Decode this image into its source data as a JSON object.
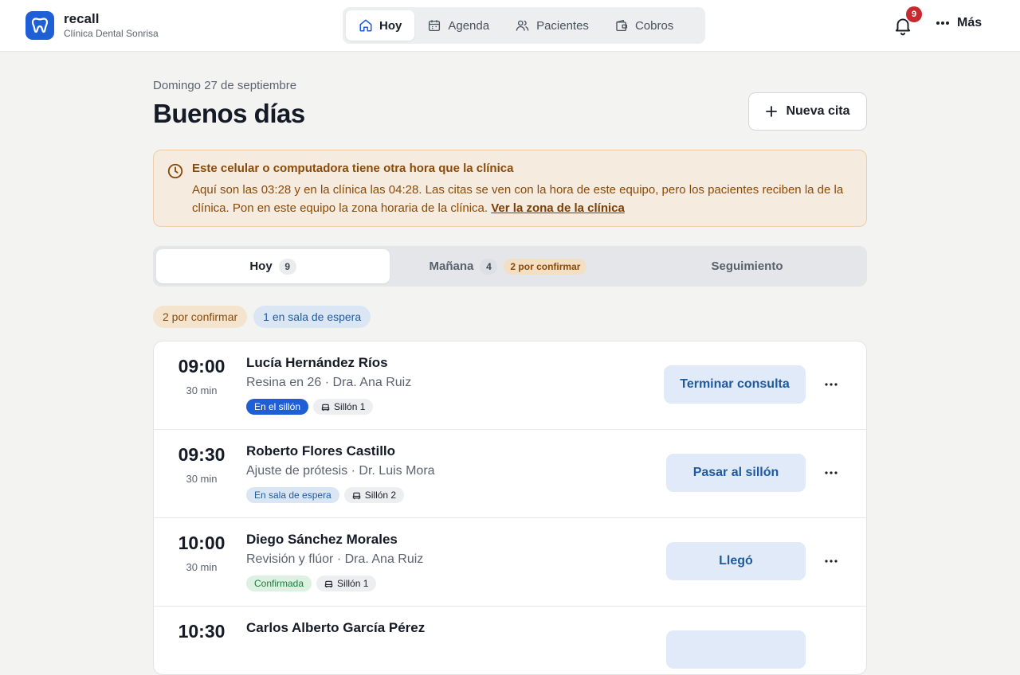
{
  "brand": {
    "name": "recall",
    "clinic": "Clínica Dental Sonrisa",
    "logo_icon": "tooth-icon",
    "color": "#1f5fd6"
  },
  "nav": [
    {
      "label": "Hoy",
      "icon": "home-icon",
      "active": true
    },
    {
      "label": "Agenda",
      "icon": "calendar-icon",
      "active": false
    },
    {
      "label": "Pacientes",
      "icon": "users-icon",
      "active": false
    },
    {
      "label": "Cobros",
      "icon": "wallet-icon",
      "active": false
    }
  ],
  "notifications": {
    "icon": "bell-icon",
    "count": "9"
  },
  "more": {
    "label": "Más",
    "icon": "more-icon"
  },
  "header": {
    "date": "Domingo 27 de septiembre",
    "greeting": "Buenos días",
    "new_button": "Nueva cita"
  },
  "alert": {
    "icon": "clock-icon",
    "title": "Este celular o computadora tiene otra hora que la clínica",
    "body": "Aquí son las 03:28 y en la clínica las 04:28. Las citas se ven con la hora de este equipo, pero los pacientes reciben la de la clínica. Pon en este equipo la zona horaria de la clínica.",
    "link": "Ver la zona de la clínica"
  },
  "tabs": [
    {
      "label": "Hoy",
      "count": "9",
      "active": true
    },
    {
      "label": "Mañana",
      "count": "4",
      "badge": "2 por confirmar",
      "active": false
    },
    {
      "label": "Seguimiento",
      "active": false
    }
  ],
  "filters": [
    "2 por confirmar",
    "1 en sala de espera"
  ],
  "appointments": [
    {
      "time": "09:00",
      "duration": "30 min",
      "patient": "Lucía Hernández Ríos",
      "detail": "Resina en 26 · Dra. Ana Ruiz",
      "status": "En el sillón",
      "chair": "Sillón 1",
      "action": "Terminar consulta"
    },
    {
      "time": "09:30",
      "duration": "30 min",
      "patient": "Roberto Flores Castillo",
      "detail": "Ajuste de prótesis · Dr. Luis Mora",
      "status": "En sala de espera",
      "chair": "Sillón 2",
      "action": "Pasar al sillón"
    },
    {
      "time": "10:00",
      "duration": "30 min",
      "patient": "Diego Sánchez Morales",
      "detail": "Revisión y flúor · Dra. Ana Ruiz",
      "status": "Confirmada",
      "chair": "Sillón 1",
      "action": "Llegó"
    },
    {
      "time": "10:30",
      "duration": "",
      "patient": "Carlos Alberto García Pérez",
      "detail": "",
      "status": "",
      "chair": "",
      "action": ""
    }
  ]
}
